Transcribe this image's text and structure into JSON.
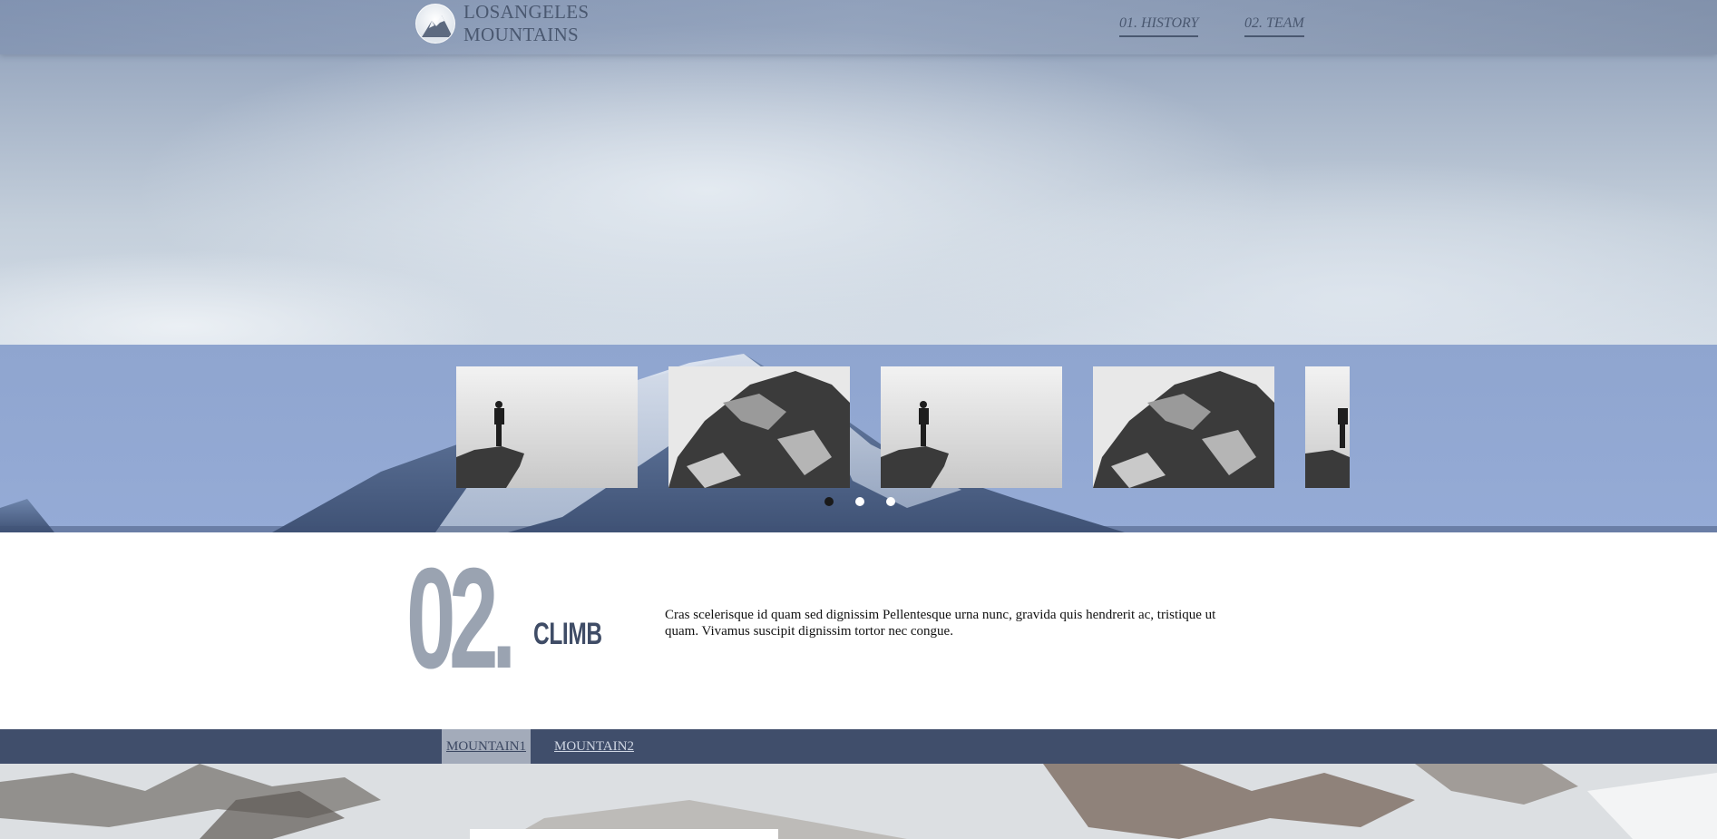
{
  "header": {
    "logo_line1": "LOSANGELES",
    "logo_line2": "MOUNTAINS",
    "logo_icon": "mountain-icon",
    "nav": [
      {
        "label": "01. HISTORY"
      },
      {
        "label": "02. TEAM"
      }
    ]
  },
  "slider": {
    "thumbnails": [
      {
        "subject": "hiker-on-cliff"
      },
      {
        "subject": "snowy-rock-face"
      },
      {
        "subject": "hiker-on-cliff"
      },
      {
        "subject": "snowy-rock-face"
      },
      {
        "subject": "hiker-on-cliff"
      }
    ],
    "dots": 3,
    "active_dot": 1
  },
  "climb": {
    "number": "02.",
    "title": "CLIMB",
    "text": "Cras scelerisque id quam sed dignissim Pellentesque urna nunc, gravida quis hendrerit ac, tristique ut quam. Vivamus suscipit dignissim tortor nec congue."
  },
  "tabs": [
    {
      "label": "MOUNTAIN1",
      "active": true
    },
    {
      "label": "MOUNTAIN2",
      "active": false
    }
  ],
  "colors": {
    "accent": "#404e6b",
    "number": "#9aa3b1",
    "slider_band": "#93a9d3"
  }
}
